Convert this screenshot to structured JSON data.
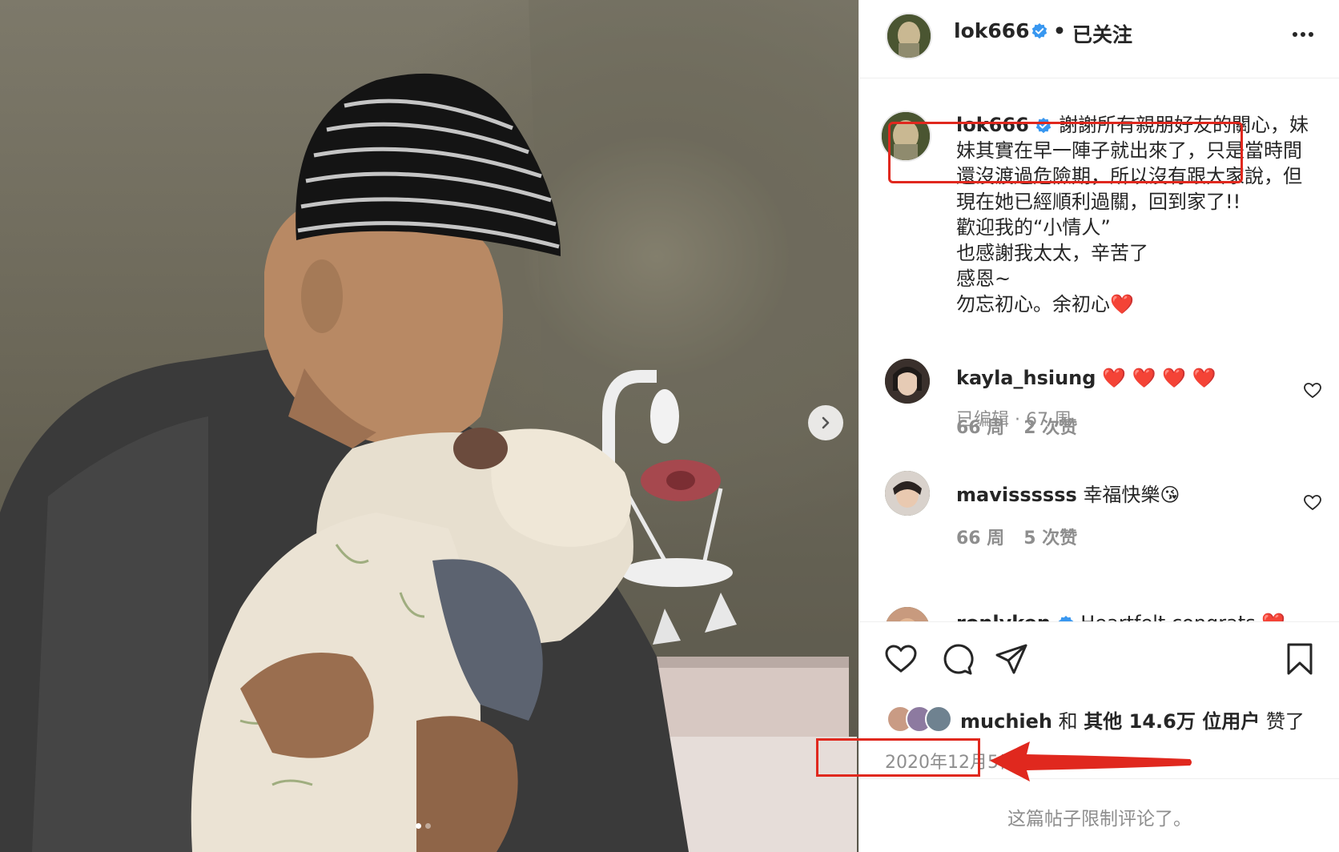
{
  "post": {
    "image_alt": "photo-carousel",
    "carousel_total": 2,
    "carousel_current": 1
  },
  "header": {
    "username": "lok666",
    "separator": "•",
    "follow_status": "已关注",
    "more_icon": "more-horizontal-icon"
  },
  "caption": {
    "username": "lok666",
    "lines": [
      "謝謝所有親朋好友的關心，妹",
      "妹其實在早一陣子就出來了，只是當時間",
      "還沒渡過危險期，所以沒有跟大家說，但",
      "現在她已經順利過關，回到家了!!",
      "歡迎我的“小情人”",
      "也感謝我太太，辛苦了",
      "感恩~",
      "勿忘初心。余初心❤️"
    ],
    "meta": "已编辑 · 67 周"
  },
  "comments": [
    {
      "username": "kayla_hsiung",
      "text": "❤️ ❤️ ❤️ ❤️",
      "time": "66 周",
      "likes": "2 次赞"
    },
    {
      "username": "mavissssss",
      "text": "幸福快樂😘",
      "time": "66 周",
      "likes": "5 次赞"
    },
    {
      "username": "ronlyken",
      "text": "Heartfelt congrats ❤️"
    }
  ],
  "likes": {
    "user": "muchieh",
    "connector": "和",
    "others": "其他 14.6万 位用户",
    "suffix": "赞了"
  },
  "date": "2020年12月5日",
  "footer": "这篇帖子限制评论了。",
  "colors": {
    "annotation_red": "#e0281e",
    "verified_blue": "#3897f0",
    "muted": "#8e8e8e"
  }
}
